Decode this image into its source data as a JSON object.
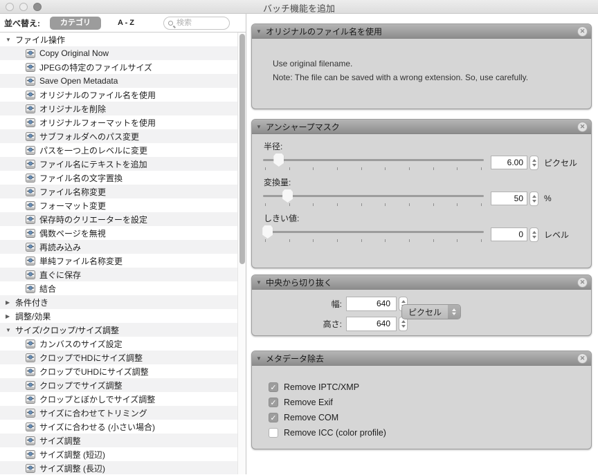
{
  "window": {
    "title": "バッチ機能を追加"
  },
  "icons": {
    "traffic_lights": [
      "close-circle",
      "minimize-circle",
      "zoom-circle-filled"
    ],
    "search": "magnifier",
    "disclosure_open": "▼",
    "disclosure_closed": "▶",
    "panel_close": "✕",
    "action_icon": "slider-action-badge"
  },
  "toolbar": {
    "sort_label": "並べ替え:",
    "segment_category": "カテゴリ",
    "segment_az": "A - Z",
    "search_placeholder": "検索"
  },
  "sidebar": {
    "rows": [
      {
        "type": "group",
        "expanded": true,
        "label": "ファイル操作"
      },
      {
        "type": "item",
        "label": "Copy Original Now"
      },
      {
        "type": "item",
        "label": "JPEGの特定のファイルサイズ"
      },
      {
        "type": "item",
        "label": "Save Open Metadata"
      },
      {
        "type": "item",
        "label": "オリジナルのファイル名を使用"
      },
      {
        "type": "item",
        "label": "オリジナルを削除"
      },
      {
        "type": "item",
        "label": "オリジナルフォーマットを使用"
      },
      {
        "type": "item",
        "label": "サブフォルダへのパス変更"
      },
      {
        "type": "item",
        "label": "パスを一つ上のレベルに変更"
      },
      {
        "type": "item",
        "label": "ファイル名にテキストを追加"
      },
      {
        "type": "item",
        "label": "ファイル名の文字置換"
      },
      {
        "type": "item",
        "label": "ファイル名称変更"
      },
      {
        "type": "item",
        "label": "フォーマット変更"
      },
      {
        "type": "item",
        "label": "保存時のクリエーターを設定"
      },
      {
        "type": "item",
        "label": "偶数ページを無視"
      },
      {
        "type": "item",
        "label": "再読み込み"
      },
      {
        "type": "item",
        "label": "単純ファイル名称変更"
      },
      {
        "type": "item",
        "label": "直ぐに保存"
      },
      {
        "type": "item",
        "label": "結合"
      },
      {
        "type": "group",
        "expanded": false,
        "label": "条件付き"
      },
      {
        "type": "group",
        "expanded": false,
        "label": "調整/効果"
      },
      {
        "type": "group",
        "expanded": true,
        "label": "サイズ/クロップ/サイズ調整"
      },
      {
        "type": "item",
        "label": "カンバスのサイズ設定"
      },
      {
        "type": "item",
        "label": "クロップでHDにサイズ調整"
      },
      {
        "type": "item",
        "label": "クロップでUHDにサイズ調整"
      },
      {
        "type": "item",
        "label": "クロップでサイズ調整"
      },
      {
        "type": "item",
        "label": "クロップとぼかしでサイズ調整"
      },
      {
        "type": "item",
        "label": "サイズに合わせてトリミング"
      },
      {
        "type": "item",
        "label": "サイズに合わせる (小さい場合)"
      },
      {
        "type": "item",
        "label": "サイズ調整"
      },
      {
        "type": "item",
        "label": "サイズ調整 (短辺)"
      },
      {
        "type": "item",
        "label": "サイズ調整 (長辺)"
      }
    ]
  },
  "panels": {
    "use_original": {
      "title": "オリジナルのファイル名を使用",
      "line1": "Use original filename.",
      "line2": "Note: The file can be saved with a wrong extension. So, use carefully."
    },
    "unsharp": {
      "title": "アンシャープマスク",
      "sliders": [
        {
          "label": "半径:",
          "value": "6.00",
          "unit": "ピクセル"
        },
        {
          "label": "変換量:",
          "value": "50",
          "unit": "%"
        },
        {
          "label": "しきい値:",
          "value": "0",
          "unit": "レベル"
        }
      ]
    },
    "crop_center": {
      "title": "中央から切り抜く",
      "width_label": "幅:",
      "width_value": "640",
      "height_label": "高さ:",
      "height_value": "640",
      "unit_popup": "ピクセル"
    },
    "metadata": {
      "title": "メタデータ除去",
      "checkboxes": [
        {
          "label": "Remove IPTC/XMP",
          "checked": true
        },
        {
          "label": "Remove Exif",
          "checked": true
        },
        {
          "label": "Remove COM",
          "checked": true
        },
        {
          "label": "Remove ICC (color profile)",
          "checked": false
        }
      ]
    }
  },
  "colors": {
    "panel_body": "#d6d6d6",
    "panel_header_top": "#b5b5b5",
    "panel_header_bottom": "#8d8d8d",
    "selected_segment": "#9c9c9c",
    "checkbox_checked": "#9d9d9d",
    "row_stripe": "#f2f2f3"
  }
}
